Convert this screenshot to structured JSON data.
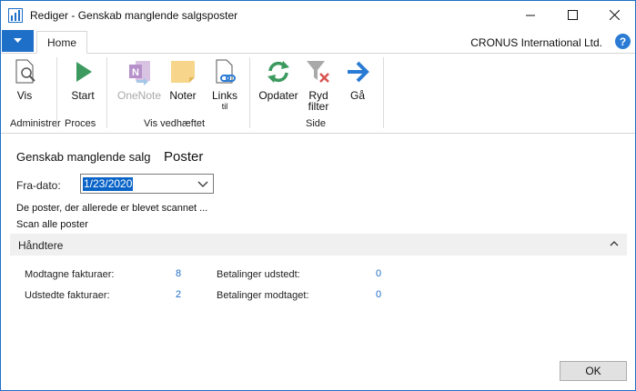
{
  "window": {
    "title": "Rediger - Genskab manglende salgsposter"
  },
  "tabs": {
    "file_label": "",
    "home": "Home"
  },
  "company": "CRONUS International Ltd.",
  "ribbon": {
    "vis": "Vis",
    "start": "Start",
    "onenote": "OneNote",
    "noter": "Noter",
    "links_line1": "Links",
    "links_line2": "til",
    "opdater": "Opdater",
    "ryd_line1": "Ryd",
    "ryd_line2": "filter",
    "ga": "Gå",
    "groups": {
      "administrer": "Administrer",
      "proces": "Proces",
      "vis_vedhaeftet": "Vis vedhæftet",
      "side": "Side"
    }
  },
  "content": {
    "header_left": "Genskab manglende salg",
    "header_right": "Poster",
    "fra_dato_label": "Fra-dato:",
    "fra_dato_value": "1/23/2020",
    "link_scanned": "De poster, der allerede er blevet scannet ...",
    "link_scan_all": "Scan alle poster",
    "fasttab": "Håndtere",
    "stats": {
      "modtagne_label": "Modtagne fakturaer:",
      "modtagne_value": "8",
      "udstedte_label": "Udstedte fakturaer:",
      "udstedte_value": "2",
      "bet_udstedt_label": "Betalinger udstedt:",
      "bet_udstedt_value": "0",
      "bet_modtaget_label": "Betalinger modtaget:",
      "bet_modtaget_value": "0"
    }
  },
  "footer": {
    "ok": "OK"
  },
  "colors": {
    "accent": "#1e6fc7",
    "selection": "#0a64c8",
    "green": "#3c9a5f"
  }
}
